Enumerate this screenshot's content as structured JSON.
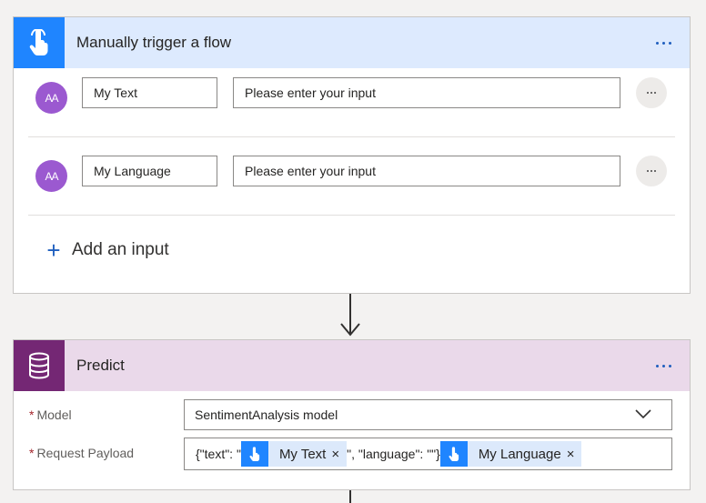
{
  "trigger": {
    "title": "Manually trigger a flow",
    "icon": "touch-hand-icon",
    "header_color": "#ddeafe",
    "icon_bg": "#1f85ff",
    "inputs": [
      {
        "name": "My Text",
        "placeholder": "Please enter your input",
        "avatar": "AA"
      },
      {
        "name": "My Language",
        "placeholder": "Please enter your input",
        "avatar": "AA"
      }
    ],
    "add_input_label": "Add an input"
  },
  "predict": {
    "title": "Predict",
    "icon": "database-icon",
    "header_color": "#ead9ea",
    "icon_bg": "#742774",
    "model_label": "Model",
    "model_value": "SentimentAnalysis model",
    "payload_label": "Request Payload",
    "payload": {
      "text_1": "{\"text\": \"",
      "token_1": "My Text",
      "text_2": "\", \"language\": \"\"}",
      "token_2": "My Language"
    }
  },
  "required_marker": "*",
  "close_glyph": "×"
}
